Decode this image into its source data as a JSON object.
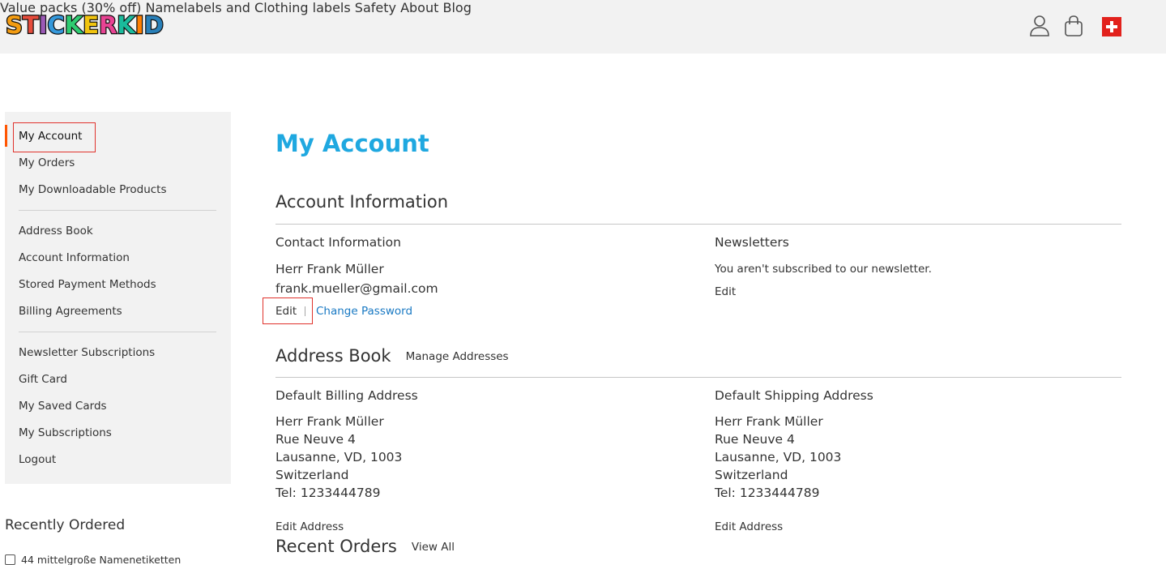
{
  "header": {
    "logo_text": "STICKERKID",
    "logo_colors": [
      "#f39c12",
      "#e74c3c",
      "#9b59b6",
      "#3498db",
      "#2ecc71",
      "#f1c40f",
      "#e84393",
      "#1abc9c",
      "#ff7f00",
      "#2980b9"
    ],
    "nav": [
      "Value packs (30% off)",
      "Namelabels and Clothing labels",
      "Safety",
      "About",
      "Blog"
    ],
    "icons": [
      "user-icon",
      "cart-icon",
      "swiss-flag-icon"
    ]
  },
  "sidebar": {
    "group1": [
      "My Account",
      "My Orders",
      "My Downloadable Products"
    ],
    "group2": [
      "Address Book",
      "Account Information",
      "Stored Payment Methods",
      "Billing Agreements"
    ],
    "group3": [
      "Newsletter Subscriptions",
      "Gift Card",
      "My Saved Cards",
      "My Subscriptions",
      "Logout"
    ],
    "active": "My Account"
  },
  "recently_ordered": {
    "title": "Recently Ordered",
    "item": "44 mittelgroße Namenetiketten"
  },
  "main": {
    "page_title": "My Account",
    "account_info": {
      "title": "Account Information",
      "contact": {
        "title": "Contact Information",
        "name": "Herr Frank Müller",
        "email": "frank.mueller@gmail.com",
        "edit": "Edit",
        "change_password": "Change Password"
      },
      "newsletters": {
        "title": "Newsletters",
        "text": "You aren't subscribed to our newsletter.",
        "edit": "Edit"
      }
    },
    "address_book": {
      "title": "Address Book",
      "manage": "Manage Addresses",
      "billing": {
        "title": "Default Billing Address",
        "lines": [
          "Herr Frank Müller",
          "Rue Neuve 4",
          "Lausanne, VD, 1003",
          "Switzerland",
          "Tel: 1233444789"
        ],
        "edit": "Edit Address"
      },
      "shipping": {
        "title": "Default Shipping Address",
        "lines": [
          "Herr Frank Müller",
          "Rue Neuve 4",
          "Lausanne, VD, 1003",
          "Switzerland",
          "Tel: 1233444789"
        ],
        "edit": "Edit Address"
      }
    },
    "recent_orders": {
      "title": "Recent Orders",
      "view_all": "View All"
    }
  },
  "colors": {
    "title_blue": "#1fa8e0",
    "link_blue": "#1979c3",
    "highlight_red": "#e0322c",
    "active_orange": "#ff5501"
  }
}
